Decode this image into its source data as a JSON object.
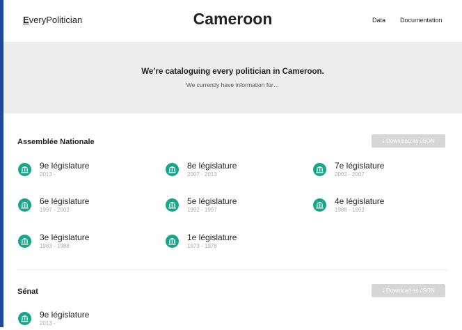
{
  "header": {
    "logo_first": "E",
    "logo_rest": "veryPolitician",
    "title": "Cameroon",
    "nav": [
      "Data",
      "Documentation"
    ]
  },
  "hero": {
    "title": "We’re cataloguing every politician in Cameroon.",
    "subtitle": "We currently have information for…"
  },
  "sections": [
    {
      "name": "Assemblée Nationale",
      "download_label": "Download as JSON",
      "items": [
        {
          "name": "9e législature",
          "years": "2013 -"
        },
        {
          "name": "8e législature",
          "years": "2007 - 2013"
        },
        {
          "name": "7e législature",
          "years": "2002 - 2007"
        },
        {
          "name": "6e législature",
          "years": "1997 - 2002"
        },
        {
          "name": "5e législature",
          "years": "1992 - 1997"
        },
        {
          "name": "4e législature",
          "years": "1988 - 1992"
        },
        {
          "name": "3e législature",
          "years": "1983 - 1988"
        },
        {
          "name": "1e législature",
          "years": "1973 - 1978"
        }
      ]
    },
    {
      "name": "Sénat",
      "download_label": "Download as JSON",
      "items": [
        {
          "name": "9e législature",
          "years": "2013 -"
        }
      ]
    }
  ],
  "colors": {
    "accent": "#1aa58a",
    "button_bg": "#d6d6d6",
    "hero_bg": "#ededed"
  }
}
